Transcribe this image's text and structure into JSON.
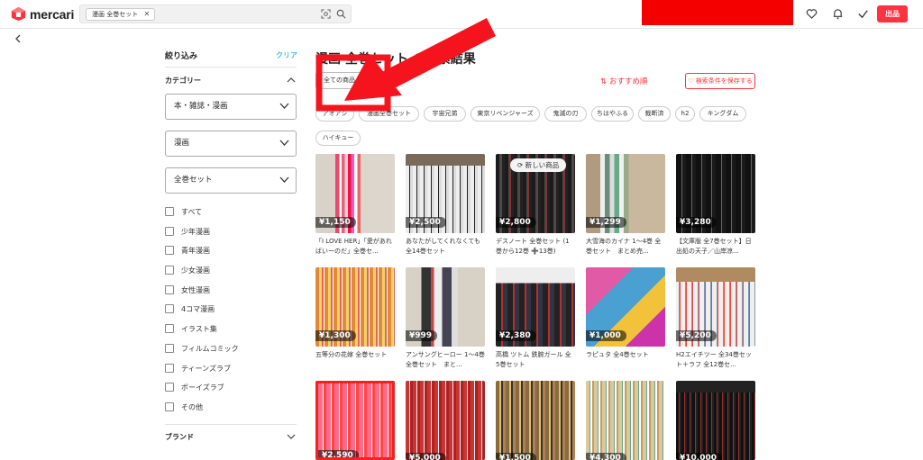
{
  "header": {
    "logo_text": "mercari",
    "search_chip": "漫画 全巻セット",
    "sell_label": "出品"
  },
  "sidebar": {
    "title": "絞り込み",
    "clear": "クリア",
    "category_title": "カテゴリー",
    "select1": "本・雑誌・漫画",
    "select2": "漫画",
    "select3": "全巻セット",
    "checkboxes": [
      "すべて",
      "少年漫画",
      "青年漫画",
      "少女漫画",
      "女性漫画",
      "4コマ漫画",
      "イラスト集",
      "フィルムコミック",
      "ティーンズラブ",
      "ボーイズラブ",
      "その他"
    ],
    "brand_title": "ブランド"
  },
  "main": {
    "title": "漫画 全巻セット の検索結果",
    "status_select": "全ての商品",
    "sort_label": "⇅ おすすめ順",
    "save_search": "♡ 検索条件を保存する",
    "tags": [
      "アオアシ",
      "漫画全巻セット",
      "宇宙兄弟",
      "東京リベンジャーズ",
      "鬼滅の刃",
      "ちはやふる",
      "裁断済",
      "h2",
      "キングダム",
      "ハイキュー"
    ],
    "new_badge": "新しい商品",
    "items": [
      {
        "price": "¥1,150",
        "caption": "「I LOVE HER」「愛があればいーのだ」全巻セ..."
      },
      {
        "price": "¥2,500",
        "caption": "あなたがしてくれなくても 全14巻セット"
      },
      {
        "price": "¥2,800",
        "caption": "デスノート 全巻セット (1巻から12巻 ➕13巻)"
      },
      {
        "price": "¥1,299",
        "caption": "大雪海のカイナ 1〜4巻 全巻セット　まとめ売..."
      },
      {
        "price": "¥3,280",
        "caption": "【文庫版 全7巻セット】日出処の天子／山岸凉..."
      },
      {
        "price": "¥1,300",
        "caption": "五等分の花嫁 全巻セット"
      },
      {
        "price": "¥999",
        "caption": "アンサングヒーロー 1〜4巻　全巻セット　まと..."
      },
      {
        "price": "¥2,380",
        "caption": "高橋 ツトム 鉄腕ガール 全5巻セット"
      },
      {
        "price": "¥1,000",
        "caption": "ラピュタ 全4巻セット"
      },
      {
        "price": "¥5,200",
        "caption": "H2エイチツー 全34巻セット＋ラフ 全12巻セ..."
      },
      {
        "price": "¥2,590",
        "caption": ""
      },
      {
        "price": "¥5,000",
        "caption": ""
      },
      {
        "price": "¥1,500",
        "caption": ""
      },
      {
        "price": "¥4,300",
        "caption": ""
      },
      {
        "price": "¥10,000",
        "caption": ""
      }
    ]
  },
  "colors": {
    "accent": "#ff333f",
    "link": "#0095ee",
    "redact": "#f40000"
  }
}
